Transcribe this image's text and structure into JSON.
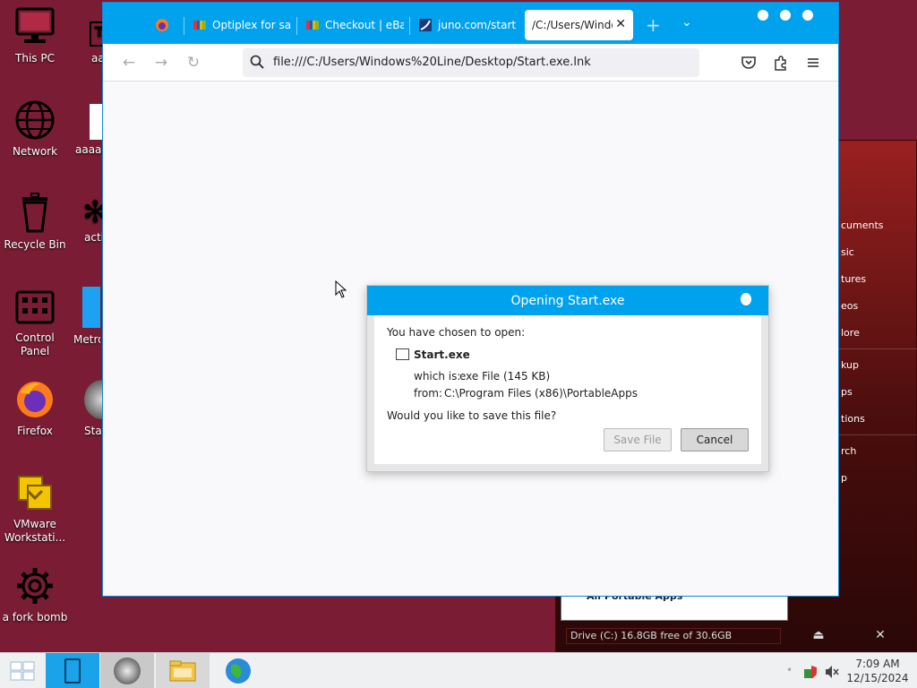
{
  "desktop": {
    "icons": [
      {
        "label": "This PC"
      },
      {
        "label": "Network"
      },
      {
        "label": "Recycle Bin"
      },
      {
        "label": "Control Panel"
      },
      {
        "label": "Firefox"
      },
      {
        "label": "VMware Workstati..."
      },
      {
        "label": "a fork bomb"
      }
    ],
    "partial_icons": [
      {
        "label": "aa"
      },
      {
        "label": "aaaaa"
      },
      {
        "label": "activ"
      },
      {
        "label": "Metro"
      },
      {
        "label": "Star"
      }
    ]
  },
  "portable_menu": {
    "items": [
      "cuments",
      "sic",
      "tures",
      "eos",
      "lore",
      "kup",
      "ps",
      "tions",
      "rch",
      "p"
    ],
    "list_item": "All Portable Apps",
    "drive_status": "Drive (C:) 16.8GB free of 30.6GB"
  },
  "browser": {
    "tabs": [
      {
        "label": "Optiplex for sa"
      },
      {
        "label": "Checkout | eBa"
      },
      {
        "label": "juno.com/start"
      },
      {
        "label": "/C:/Users/Windo"
      }
    ],
    "new_tab": "+",
    "url": "file:///C:/Users/Windows%20Line/Desktop/Start.exe.lnk"
  },
  "dialog": {
    "title": "Opening Start.exe",
    "intro": "You have chosen to open:",
    "filename": "Start.exe",
    "which_is_label": "which is:",
    "which_is_value": "exe File (145 KB)",
    "from_label": "from:",
    "from_value": "C:\\Program Files (x86)\\PortableApps",
    "question": "Would you like to save this file?",
    "save_label": "Save File",
    "cancel_label": "Cancel"
  },
  "taskbar": {
    "time": "7:09 AM",
    "date": "12/15/2024"
  },
  "colors": {
    "desktop_bg": "#7a1c34",
    "accent": "#00a2ed"
  }
}
